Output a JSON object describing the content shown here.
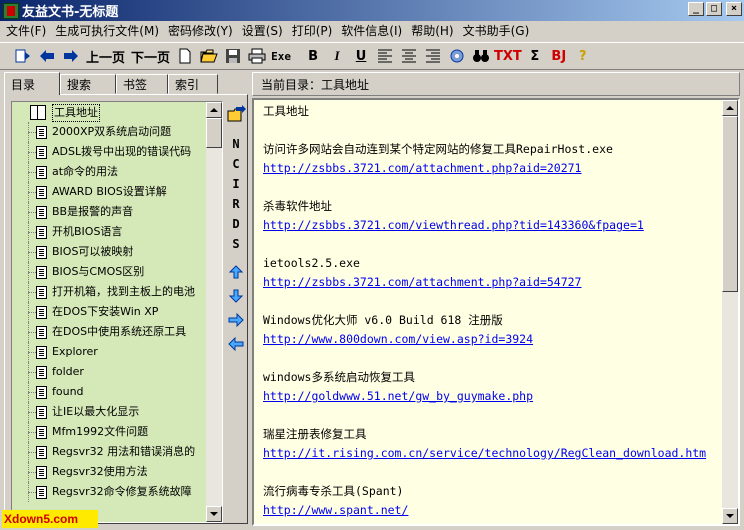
{
  "window": {
    "title": "友益文书-无标题"
  },
  "menu": [
    "文件(F)",
    "生成可执行文件(M)",
    "密码修改(Y)",
    "设置(S)",
    "打印(P)",
    "软件信息(I)",
    "帮助(H)",
    "文书助手(G)"
  ],
  "toolbar": {
    "prev_label": "上一页",
    "next_label": "下一页",
    "exe_label": "Exe",
    "bold_label": "B",
    "italic_label": "I",
    "underline_label": "U",
    "txt_label": "TXT",
    "sigma_label": "Σ",
    "bj_label": "BJ",
    "help_label": "?"
  },
  "tabs": [
    "目录",
    "搜索",
    "书签",
    "索引"
  ],
  "tree": {
    "root": "工具地址",
    "items": [
      "2000XP双系统启动问题",
      "ADSL拨号中出现的错误代码",
      "at命令的用法",
      "AWARD BIOS设置详解",
      "BB是报警的声音",
      "开机BIOS语言",
      "BIOS可以被映射",
      "BIOS与CMOS区别",
      "打开机箱，找到主板上的电池",
      "在DOS下安装Win XP",
      "在DOS中使用系统还原工具",
      "Explorer",
      "folder",
      "found",
      "让IE以最大化显示",
      "Mfm1992文件问题",
      "Regsvr32 用法和错误消息的",
      "Regsvr32使用方法",
      "Regsvr32命令修复系统故障"
    ]
  },
  "side_tools": [
    "N",
    "C",
    "I",
    "R",
    "D",
    "S"
  ],
  "header": {
    "current_dir": "当前目录：工具地址"
  },
  "editor": {
    "lines": [
      {
        "text": "工具地址",
        "link": false
      },
      {
        "text": "",
        "link": false
      },
      {
        "text": "访问许多网站会自动连到某个特定网站的修复工具RepairHost.exe",
        "link": false
      },
      {
        "text": "http://zsbbs.3721.com/attachment.php?aid=20271",
        "link": true
      },
      {
        "text": "",
        "link": false
      },
      {
        "text": "杀毒软件地址",
        "link": false
      },
      {
        "text": "http://zsbbs.3721.com/viewthread.php?tid=143360&fpage=1",
        "link": true
      },
      {
        "text": "",
        "link": false
      },
      {
        "text": "ietools2.5.exe",
        "link": false
      },
      {
        "text": "http://zsbbs.3721.com/attachment.php?aid=54727",
        "link": true
      },
      {
        "text": "",
        "link": false
      },
      {
        "text": "Windows优化大师 v6.0 Build 618 注册版",
        "link": false
      },
      {
        "text": "http://www.800down.com/view.asp?id=3924",
        "link": true
      },
      {
        "text": "",
        "link": false
      },
      {
        "text": "windows多系统启动恢复工具",
        "link": false
      },
      {
        "text": "http://goldwww.51.net/gw_by_guymake.php",
        "link": true
      },
      {
        "text": "",
        "link": false
      },
      {
        "text": "瑞星注册表修复工具",
        "link": false
      },
      {
        "text": "http://it.rising.com.cn/service/technology/RegClean_download.htm",
        "link": true
      },
      {
        "text": "",
        "link": false
      },
      {
        "text": "流行病毒专杀工具(Spant)",
        "link": false
      },
      {
        "text": "http://www.spant.net/",
        "link": true
      }
    ]
  },
  "watermark": "Xdown5.com"
}
